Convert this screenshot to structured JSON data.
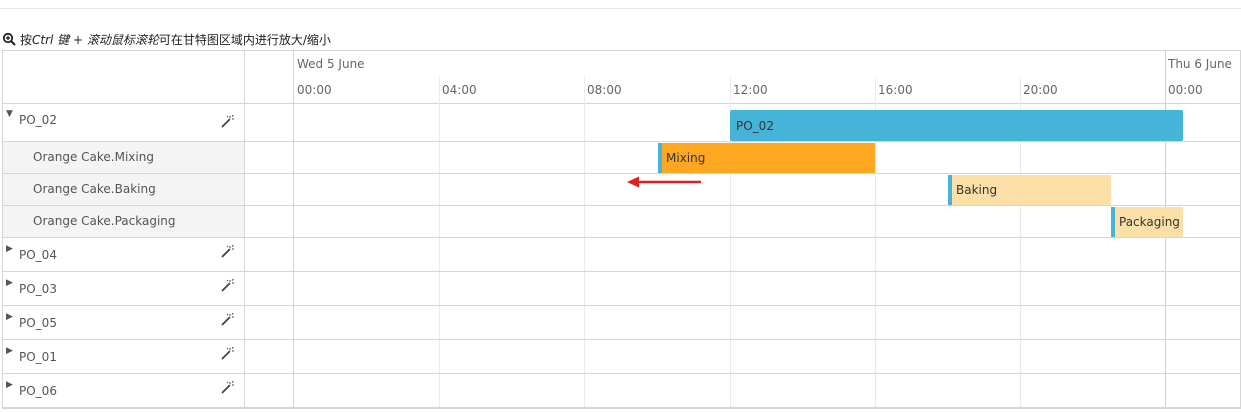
{
  "hint": {
    "prefix": "按 ",
    "key": "Ctrl 键 + 滚动鼠标滚轮",
    "suffix": "可在甘特图区域内进行放大/缩小"
  },
  "timeline": {
    "days": [
      "Wed 5 June",
      "Thu 6 June"
    ],
    "hours": [
      "00:00",
      "04:00",
      "08:00",
      "12:00",
      "16:00",
      "20:00",
      "00:00"
    ]
  },
  "rows": [
    {
      "label": "PO_02",
      "type": "parent",
      "expanded": true
    },
    {
      "label": "Orange Cake.Mixing",
      "type": "child"
    },
    {
      "label": "Orange Cake.Baking",
      "type": "child"
    },
    {
      "label": "Orange Cake.Packaging",
      "type": "child"
    },
    {
      "label": "PO_04",
      "type": "parent",
      "expanded": false
    },
    {
      "label": "PO_03",
      "type": "parent",
      "expanded": false
    },
    {
      "label": "PO_05",
      "type": "parent",
      "expanded": false
    },
    {
      "label": "PO_01",
      "type": "parent",
      "expanded": false
    },
    {
      "label": "PO_06",
      "type": "parent",
      "expanded": false
    }
  ],
  "bars": [
    {
      "label": "PO_02",
      "color": "#46b4d8"
    },
    {
      "label": "Mixing",
      "color": "#fea822"
    },
    {
      "label": "Baking",
      "color": "#fde0a8"
    },
    {
      "label": "Packaging",
      "color": "#fde0a8"
    }
  ],
  "icons": {
    "toggle_expanded": "triangle-down-icon",
    "toggle_collapsed": "triangle-right-icon",
    "row_action": "magic-wand-icon",
    "hint": "zoom-in-icon",
    "annotation": "red-left-arrow"
  },
  "colors": {
    "grid": "#d6d6d6",
    "arrow": "#e02020"
  }
}
